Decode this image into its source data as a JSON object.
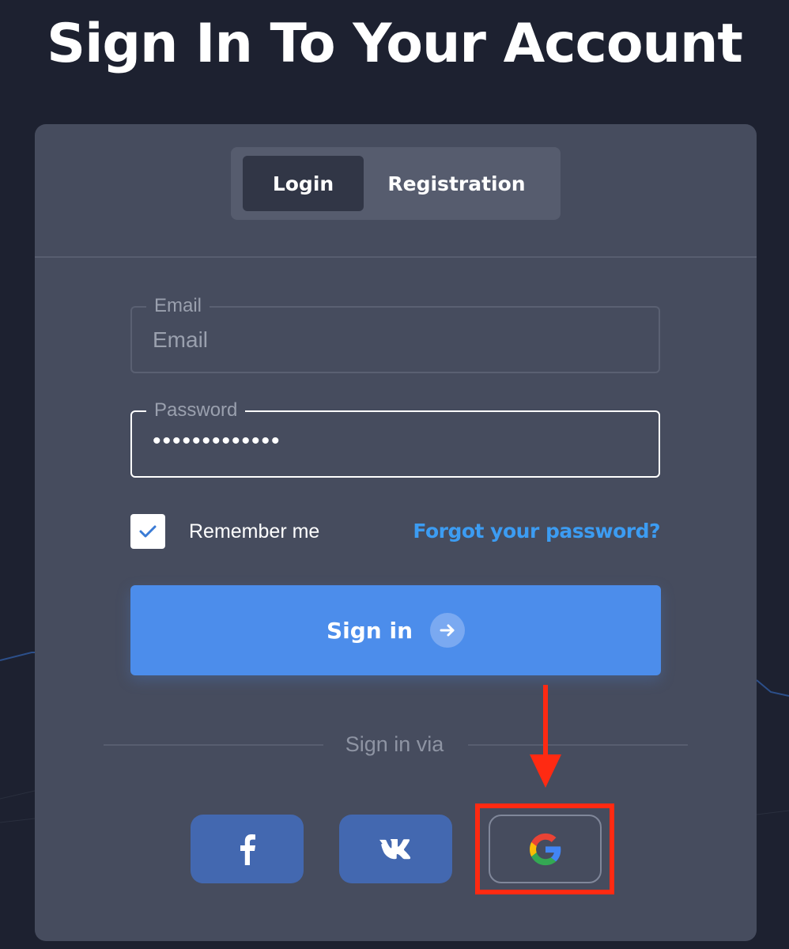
{
  "page": {
    "title": "Sign In To Your Account"
  },
  "tabs": [
    {
      "label": "Login",
      "active": true
    },
    {
      "label": "Registration",
      "active": false
    }
  ],
  "form": {
    "email": {
      "legend": "Email",
      "placeholder": "Email",
      "value": ""
    },
    "password": {
      "legend": "Password",
      "value": "•••••••••••••"
    },
    "remember": {
      "label": "Remember me",
      "checked": true
    },
    "forgot_label": "Forgot your password?",
    "submit_label": "Sign in"
  },
  "social": {
    "heading": "Sign in via",
    "providers": [
      {
        "name": "facebook",
        "icon": "facebook-icon"
      },
      {
        "name": "vk",
        "icon": "vk-icon"
      },
      {
        "name": "google",
        "icon": "google-icon",
        "highlighted": true
      }
    ]
  },
  "colors": {
    "background": "#1d2130",
    "card": "#464c5e",
    "primary": "#4c8deb",
    "link": "#3c9cf2",
    "social_button": "#4368b0",
    "annotation": "#ff2a12"
  }
}
